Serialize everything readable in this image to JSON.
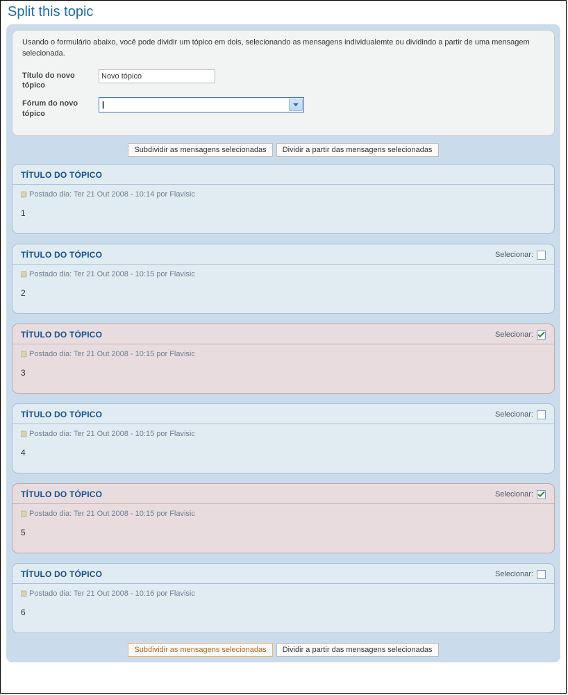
{
  "page": {
    "title": "Split this topic",
    "description": "Usando o formulário abaixo, você pode dividir um tópico em dois, selecionando as mensagens individualemte ou dividindo a partir de uma mensagem selecionada."
  },
  "form": {
    "new_title_label": "Título do novo tópico",
    "new_title_value": "Novo tópico",
    "new_forum_label": "Fórum do novo tópico",
    "new_forum_value": ""
  },
  "top_buttons": {
    "split_selected": "Subdividir as mensagens selecionadas",
    "split_from": "Dividir a partir das mensagens selecionadas"
  },
  "bottom_buttons": {
    "split_selected": "Subdividir as mensagens selecionadas",
    "split_from": "Dividir a partir das mensagens selecionadas"
  },
  "strings": {
    "select_label": "Selecionar:"
  },
  "posts": [
    {
      "title": "TÍTULO DO TÓPICO",
      "meta": "Postado dia: Ter 21 Out 2008 - 10:14 por Flavisic",
      "content": "1",
      "show_select": false,
      "checked": false
    },
    {
      "title": "TÍTULO DO TÓPICO",
      "meta": "Postado dia: Ter 21 Out 2008 - 10:15 por Flavisic",
      "content": "2",
      "show_select": true,
      "checked": false
    },
    {
      "title": "TÍTULO DO TÓPICO",
      "meta": "Postado dia: Ter 21 Out 2008 - 10:15 por Flavisic",
      "content": "3",
      "show_select": true,
      "checked": true
    },
    {
      "title": "TÍTULO DO TÓPICO",
      "meta": "Postado dia: Ter 21 Out 2008 - 10:15 por Flavisic",
      "content": "4",
      "show_select": true,
      "checked": false
    },
    {
      "title": "TÍTULO DO TÓPICO",
      "meta": "Postado dia: Ter 21 Out 2008 - 10:15 por Flavisic",
      "content": "5",
      "show_select": true,
      "checked": true
    },
    {
      "title": "TÍTULO DO TÓPICO",
      "meta": "Postado dia: Ter 21 Out 2008 - 10:16 por Flavisic",
      "content": "6",
      "show_select": true,
      "checked": false
    }
  ]
}
